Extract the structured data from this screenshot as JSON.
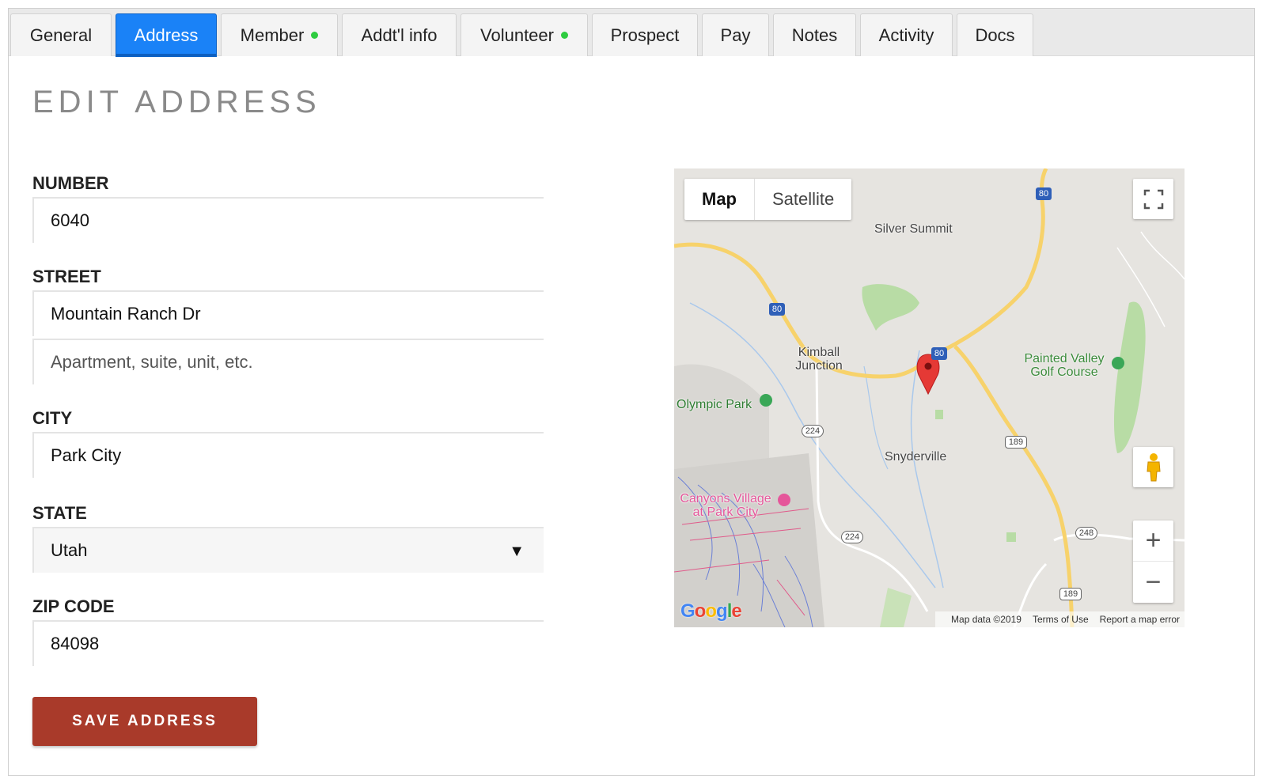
{
  "tabs": [
    {
      "label": "General",
      "dot": false
    },
    {
      "label": "Address",
      "dot": false,
      "active": true
    },
    {
      "label": "Member",
      "dot": true
    },
    {
      "label": "Addt'l info",
      "dot": false
    },
    {
      "label": "Volunteer",
      "dot": true
    },
    {
      "label": "Prospect",
      "dot": false
    },
    {
      "label": "Pay",
      "dot": false
    },
    {
      "label": "Notes",
      "dot": false
    },
    {
      "label": "Activity",
      "dot": false
    },
    {
      "label": "Docs",
      "dot": false
    }
  ],
  "page_title": "EDIT ADDRESS",
  "form": {
    "number_label": "NUMBER",
    "number_value": "6040",
    "street_label": "STREET",
    "street_value": "Mountain Ranch Dr",
    "street2_placeholder": "Apartment, suite, unit, etc.",
    "city_label": "CITY",
    "city_value": "Park City",
    "state_label": "STATE",
    "state_value": "Utah",
    "zip_label": "ZIP CODE",
    "zip_value": "84098",
    "save_label": "SAVE ADDRESS"
  },
  "map": {
    "type_map": "Map",
    "type_satellite": "Satellite",
    "places": {
      "silver_summit": "Silver Summit",
      "kimball_1": "Kimball",
      "kimball_2": "Junction",
      "painted_1": "Painted Valley",
      "painted_2": "Golf Course",
      "olympic": "Olympic Park",
      "snyderville": "Snyderville",
      "canyons_1": "Canyons Village",
      "canyons_2": "at Park City"
    },
    "shields": {
      "i80": "80",
      "r224": "224",
      "r189": "189",
      "r248": "248"
    },
    "footer": {
      "data": "Map data ©2019",
      "terms": "Terms of Use",
      "report": "Report a map error"
    },
    "logo": "Google",
    "colors": {
      "accent": "#1a82f7",
      "save": "#a93a2a",
      "dot": "#2ecc40",
      "pin": "#e53935",
      "road": "#f7d26b"
    }
  }
}
